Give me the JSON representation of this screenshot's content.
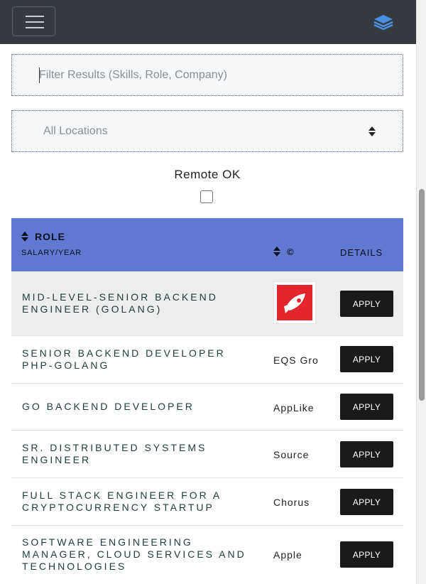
{
  "navbar": {
    "menu_icon": "hamburger-menu-icon",
    "brand_icon": "layers-icon",
    "brand_color": "#4a8fe0"
  },
  "filter": {
    "placeholder": "Filter Results (Skills, Role, Company)"
  },
  "location": {
    "selected": "All Locations",
    "icon": "sort-arrows-icon"
  },
  "remote": {
    "label": "Remote OK",
    "checked": false
  },
  "table": {
    "header_color": "#6179d0",
    "headers": {
      "role": "ROLE",
      "salary": "SALARY/YEAR",
      "company": "©",
      "details": "DETAILS"
    },
    "rows": [
      {
        "role": "MID-LEVEL-SENIOR BACKEND ENGINEER (GOLANG)",
        "company": "",
        "logo": "rocket-logo-icon",
        "action": "APPLY"
      },
      {
        "role": "SENIOR BACKEND DEVELOPER PHP-GOLANG",
        "company": "EQS Gro",
        "action": "APPLY"
      },
      {
        "role": "GO BACKEND DEVELOPER",
        "company": "AppLike",
        "action": "APPLY"
      },
      {
        "role": "SR. DISTRIBUTED SYSTEMS ENGINEER",
        "company": "Source",
        "action": "APPLY"
      },
      {
        "role": "FULL STACK ENGINEER FOR A CRYPTOCURRENCY STARTUP",
        "company": "Chorus",
        "action": "APPLY"
      },
      {
        "role": "SOFTWARE ENGINEERING MANAGER, CLOUD SERVICES AND TECHNOLOGIES",
        "company": "Apple",
        "action": "APPLY"
      }
    ]
  }
}
